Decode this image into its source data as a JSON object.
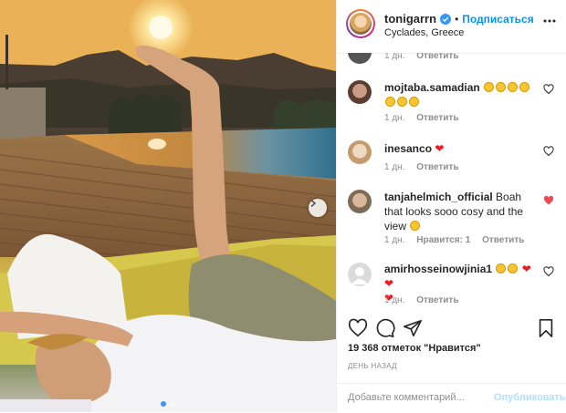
{
  "header": {
    "username": "tonigarrn",
    "bullet": "•",
    "follow_label": "Подписаться",
    "location": "Cyclades, Greece"
  },
  "comments": [
    {
      "username": "",
      "text": "",
      "time": "1 дн.",
      "likes": "",
      "reply": "Ответить",
      "liked": false
    },
    {
      "username": "mojtaba.samadian",
      "text": "",
      "emoji": [
        "smiling-face",
        "smiling-face",
        "smiling-face",
        "smiling-face",
        "smiling-face",
        "smiling-face",
        "smiling-face"
      ],
      "time": "1 дн.",
      "likes": "",
      "reply": "Ответить",
      "liked": false
    },
    {
      "username": "inesanco",
      "text": "❤",
      "time": "1 дн.",
      "likes": "",
      "reply": "Ответить",
      "liked": false
    },
    {
      "username": "tanjahelmich_official",
      "text": "Boah that looks sooo cosy and the view",
      "emoji": [
        "heart-eyes-face"
      ],
      "time": "1 дн.",
      "likes": "Нравится: 1",
      "reply": "Ответить",
      "liked": true
    },
    {
      "username": "amirhosseinowjinia1",
      "text": "",
      "emoji": [
        "face-screaming",
        "face-screaming",
        "heart",
        "heart",
        "heart"
      ],
      "time": "1 дн.",
      "likes": "",
      "reply": "Ответить",
      "liked": false
    }
  ],
  "post": {
    "likes": "19 368 отметок \"Нравится\"",
    "time": "ДЕНЬ НАЗАД",
    "comment_placeholder": "Добавьте комментарий...",
    "publish_label": "Опубликовать",
    "carousel": {
      "count": 2,
      "active": 1
    }
  },
  "icons": {
    "like": "heart-outline-icon",
    "comment": "speech-bubble-icon",
    "share": "paper-plane-icon",
    "save": "bookmark-icon",
    "next": "chevron-right-icon",
    "more": "ellipsis-icon",
    "verified": "verified-badge-icon"
  },
  "colors": {
    "accent": "#0095f6",
    "liked": "#ed4956",
    "muted": "#8e8e8e",
    "publish_disabled": "#b2dffc"
  }
}
